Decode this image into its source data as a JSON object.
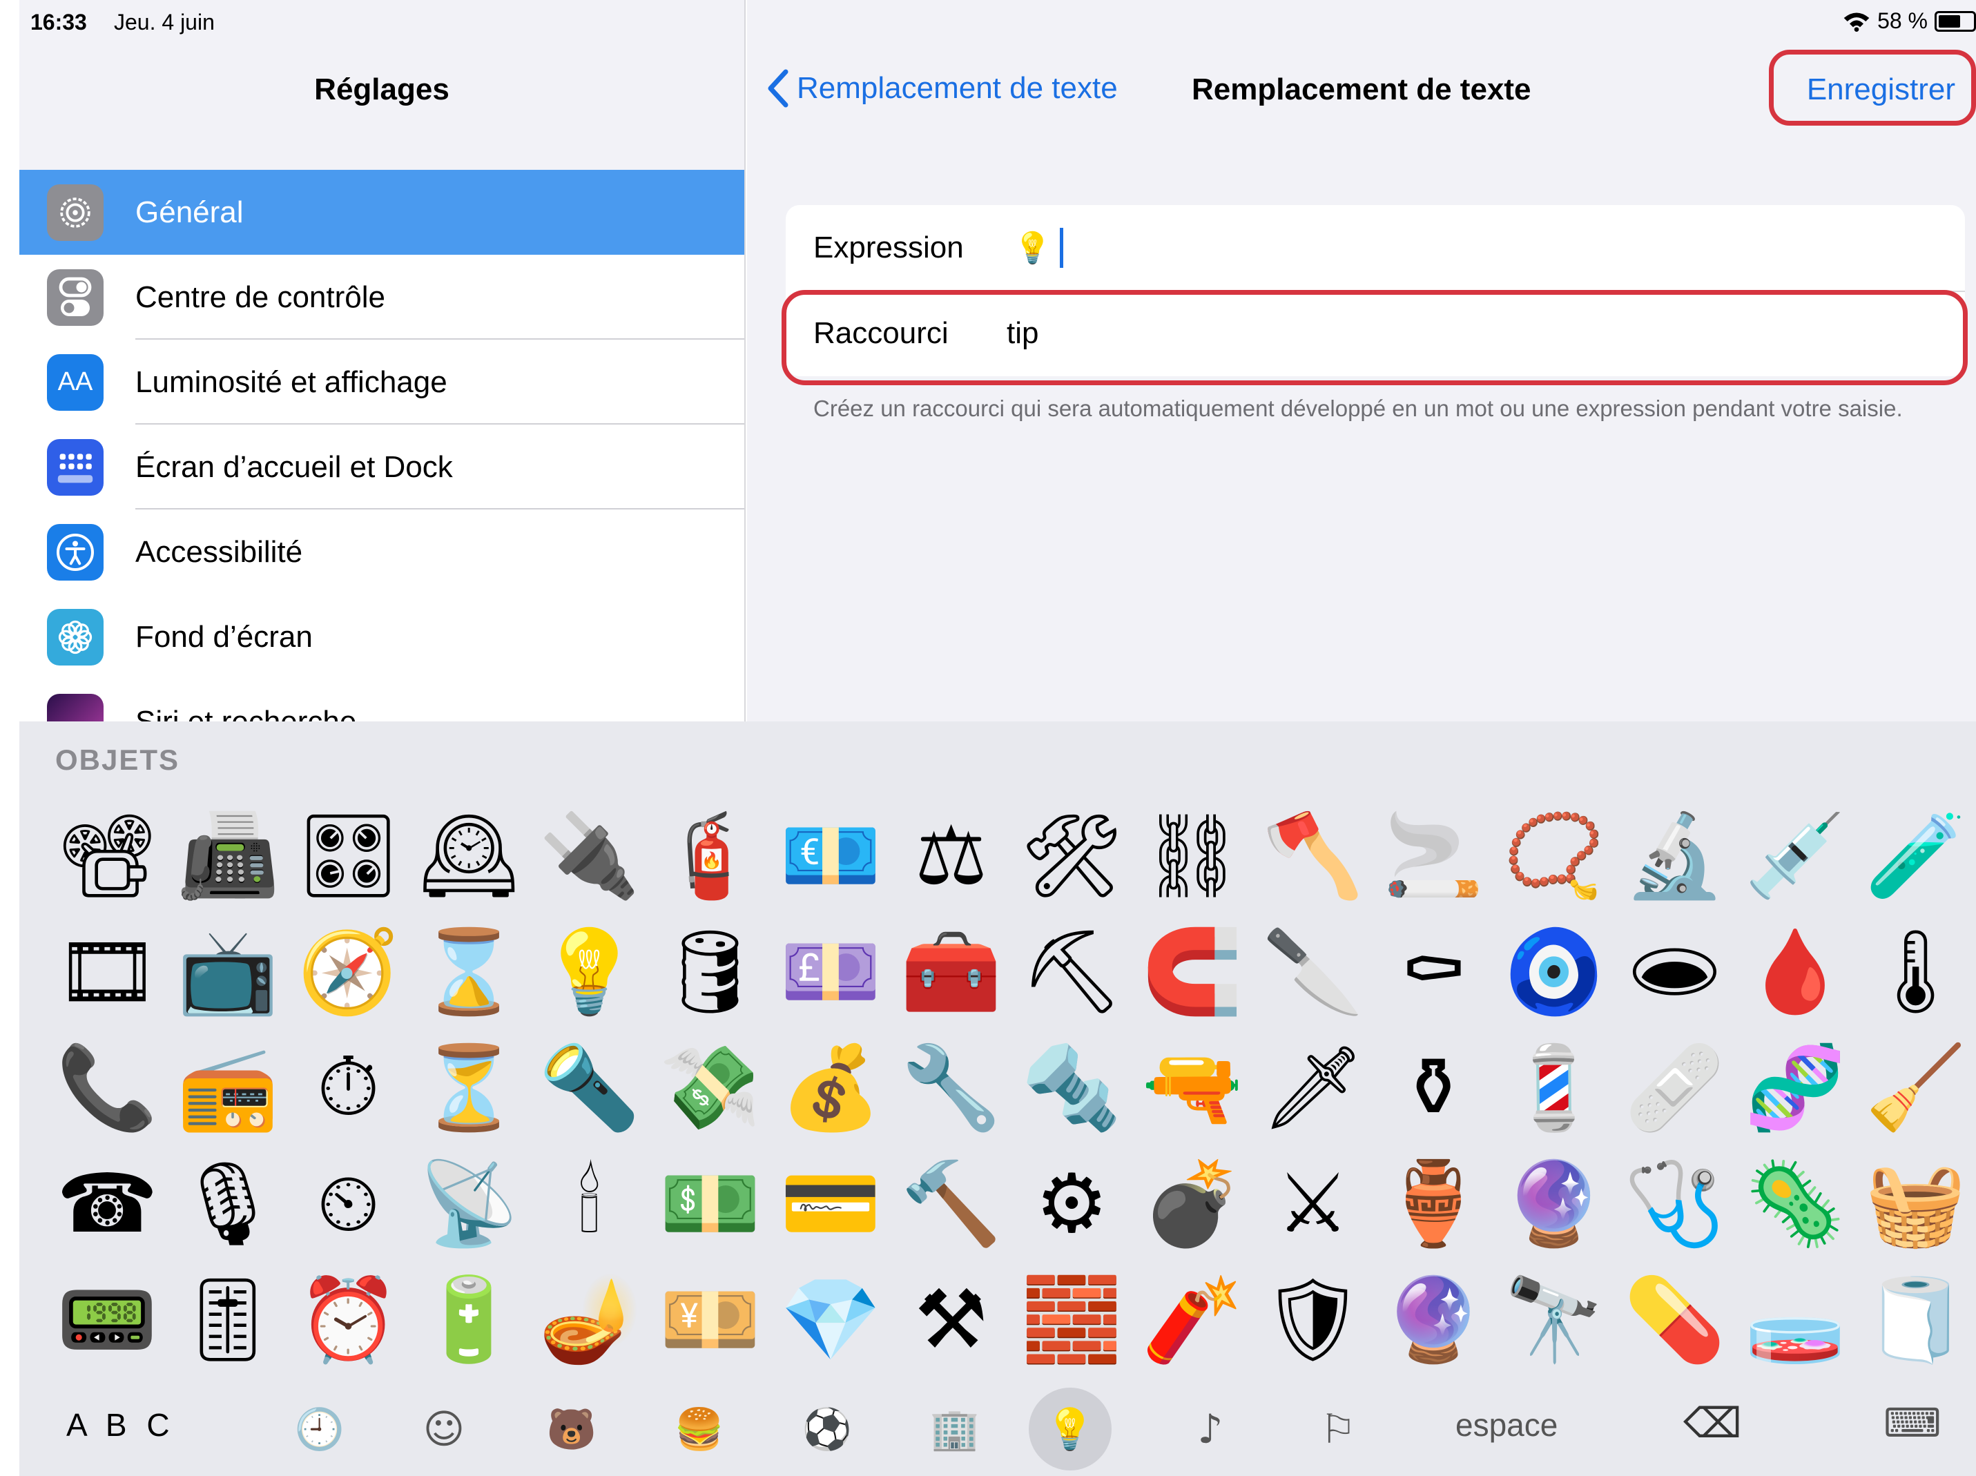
{
  "status": {
    "time": "16:33",
    "date": "Jeu. 4 juin",
    "battery": "58 %",
    "battery_level": 0.58
  },
  "sidebar": {
    "title": "Réglages",
    "items": [
      {
        "label": "Général",
        "icon": "gear-icon",
        "color": "#8e8e93",
        "selected": true
      },
      {
        "label": "Centre de contrôle",
        "icon": "toggles-icon",
        "color": "#8e8e93"
      },
      {
        "label": "Luminosité et affichage",
        "icon": "text-size-icon",
        "color": "#1a7ee8"
      },
      {
        "label": "Écran d’accueil et Dock",
        "icon": "home-screen-grid-icon",
        "color": "#2f5fe8"
      },
      {
        "label": "Accessibilité",
        "icon": "accessibility-icon",
        "color": "#1a7ee8"
      },
      {
        "label": "Fond d’écran",
        "icon": "flower-icon",
        "color": "#34aadc"
      },
      {
        "label": "Siri et recherche",
        "icon": "siri-icon",
        "color": "#5a2b8c"
      }
    ]
  },
  "nav": {
    "back_label": "Remplacement de texte",
    "title": "Remplacement de texte",
    "save_label": "Enregistrer"
  },
  "form": {
    "phrase_label": "Expression",
    "phrase_value": "💡",
    "shortcut_label": "Raccourci",
    "shortcut_value": "tip",
    "footer": "Créez un raccourci qui sera automatiquement développé en un mot ou une expression pendant votre saisie."
  },
  "keyboard": {
    "section_title": "OBJETS",
    "emoji_rows": [
      [
        "📽",
        "📠",
        "🎛",
        "🕰",
        "🔌",
        "🧯",
        "💶",
        "⚖",
        "🛠",
        "⛓",
        "🪓",
        "🚬",
        "📿",
        "🔬",
        "💉",
        "🧪"
      ],
      [
        "🎞",
        "📺",
        "🧭",
        "⌛",
        "💡",
        "🛢",
        "💷",
        "🧰",
        "⛏",
        "🧲",
        "🔪",
        "⚰",
        "🧿",
        "🕳",
        "🩸",
        "🌡"
      ],
      [
        "📞",
        "📻",
        "⏱",
        "⏳",
        "🔦",
        "💸",
        "💰",
        "🔧",
        "🔩",
        "🔫",
        "🗡",
        "⚱",
        "💈",
        "🩹",
        "🧬",
        "🧹"
      ],
      [
        "☎",
        "🎙",
        "⏲",
        "📡",
        "🕯",
        "💵",
        "💳",
        "🔨",
        "⚙",
        "💣",
        "⚔",
        "🏺",
        "🔮",
        "🩺",
        "🦠",
        "🧺"
      ],
      [
        "📟",
        "🎚",
        "⏰",
        "🔋",
        "🪔",
        "💴",
        "💎",
        "⚒",
        "🧱",
        "🧨",
        "🛡",
        "🔮",
        "🔭",
        "💊",
        "🧫",
        "🧻"
      ]
    ],
    "abc_label": "A B C",
    "space_label": "espace",
    "categories": [
      {
        "name": "recent-icon",
        "glyph": "🕘"
      },
      {
        "name": "smileys-icon",
        "glyph": "☺"
      },
      {
        "name": "animals-icon",
        "glyph": "🐻"
      },
      {
        "name": "food-icon",
        "glyph": "🍔"
      },
      {
        "name": "activity-icon",
        "glyph": "⚽"
      },
      {
        "name": "travel-icon",
        "glyph": "🏢"
      },
      {
        "name": "objects-icon",
        "glyph": "💡",
        "active": true
      },
      {
        "name": "symbols-icon",
        "glyph": "♪"
      },
      {
        "name": "flags-icon",
        "glyph": "⚐"
      }
    ],
    "delete_glyph": "⌫",
    "dismiss_glyph": "⌨"
  },
  "colors": {
    "accent": "#1a6fe3",
    "selected_row": "#4a9aef",
    "highlight": "#d6343f"
  }
}
